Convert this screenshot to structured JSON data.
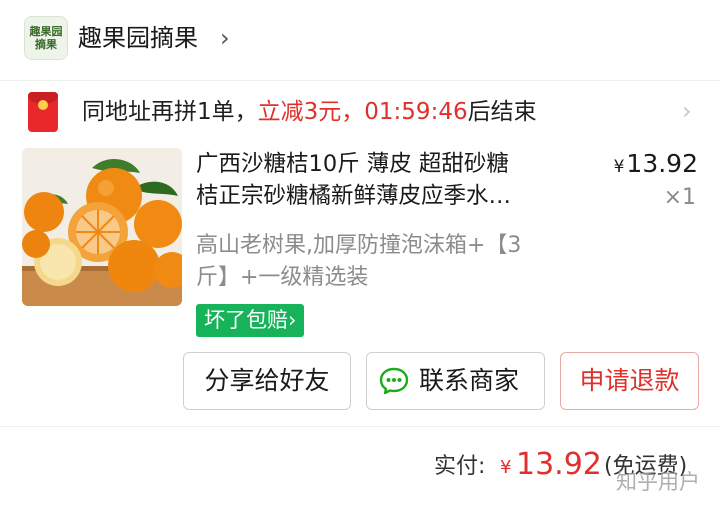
{
  "shop": {
    "logo_line1": "趣果园",
    "logo_line2": "摘果",
    "name": "趣果园摘果",
    "chevron": "›"
  },
  "promo": {
    "icon": "red-packet-icon",
    "prefix": "同地址再拼1单，",
    "discount": "立减3元，",
    "countdown": "01:59:46",
    "suffix": "后结束",
    "chevron": "›"
  },
  "product": {
    "image_icon": "mandarin-oranges-photo",
    "title_line1": "广西沙糖桔10斤 薄皮 超甜砂糖",
    "title_line2": "桔正宗砂糖橘新鲜薄皮应季水…",
    "currency": "¥",
    "price": "13.92",
    "quantity": "×1",
    "spec_line1": "高山老树果,加厚防撞泡沫箱+【3",
    "spec_line2": "斤】+一级精选装",
    "badge": "坏了包赔›"
  },
  "actions": {
    "share": "分享给好友",
    "contact": "联系商家",
    "refund": "申请退款"
  },
  "total": {
    "label": "实付:",
    "currency": "¥",
    "amount": "13.92",
    "shipping": "(免运费)"
  },
  "watermark": "知乎用户",
  "colors": {
    "accent_red": "#e0302b",
    "badge_green": "#17b35a",
    "chat_green": "#1aad19"
  }
}
